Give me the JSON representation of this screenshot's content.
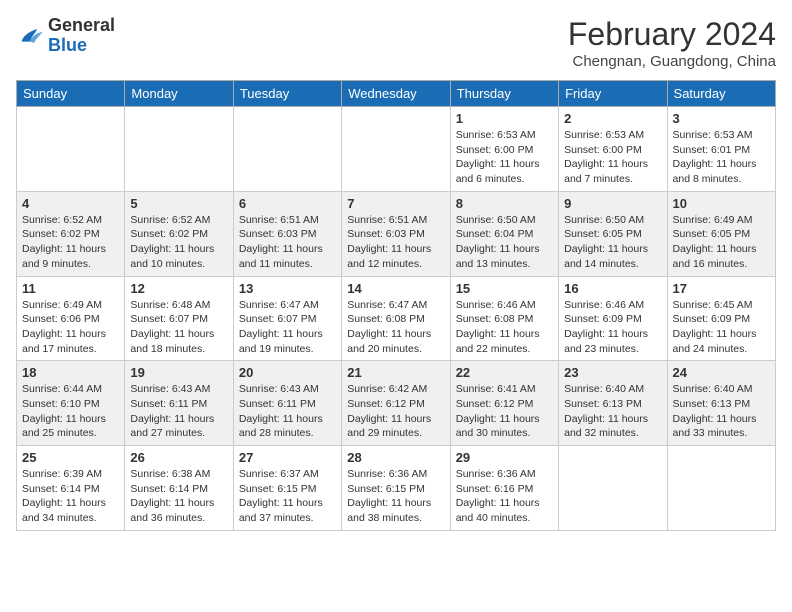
{
  "header": {
    "logo_general": "General",
    "logo_blue": "Blue",
    "month_title": "February 2024",
    "location": "Chengnan, Guangdong, China"
  },
  "weekdays": [
    "Sunday",
    "Monday",
    "Tuesday",
    "Wednesday",
    "Thursday",
    "Friday",
    "Saturday"
  ],
  "weeks": [
    [
      {
        "day": "",
        "info": ""
      },
      {
        "day": "",
        "info": ""
      },
      {
        "day": "",
        "info": ""
      },
      {
        "day": "",
        "info": ""
      },
      {
        "day": "1",
        "info": "Sunrise: 6:53 AM\nSunset: 6:00 PM\nDaylight: 11 hours and 6 minutes."
      },
      {
        "day": "2",
        "info": "Sunrise: 6:53 AM\nSunset: 6:00 PM\nDaylight: 11 hours and 7 minutes."
      },
      {
        "day": "3",
        "info": "Sunrise: 6:53 AM\nSunset: 6:01 PM\nDaylight: 11 hours and 8 minutes."
      }
    ],
    [
      {
        "day": "4",
        "info": "Sunrise: 6:52 AM\nSunset: 6:02 PM\nDaylight: 11 hours and 9 minutes."
      },
      {
        "day": "5",
        "info": "Sunrise: 6:52 AM\nSunset: 6:02 PM\nDaylight: 11 hours and 10 minutes."
      },
      {
        "day": "6",
        "info": "Sunrise: 6:51 AM\nSunset: 6:03 PM\nDaylight: 11 hours and 11 minutes."
      },
      {
        "day": "7",
        "info": "Sunrise: 6:51 AM\nSunset: 6:03 PM\nDaylight: 11 hours and 12 minutes."
      },
      {
        "day": "8",
        "info": "Sunrise: 6:50 AM\nSunset: 6:04 PM\nDaylight: 11 hours and 13 minutes."
      },
      {
        "day": "9",
        "info": "Sunrise: 6:50 AM\nSunset: 6:05 PM\nDaylight: 11 hours and 14 minutes."
      },
      {
        "day": "10",
        "info": "Sunrise: 6:49 AM\nSunset: 6:05 PM\nDaylight: 11 hours and 16 minutes."
      }
    ],
    [
      {
        "day": "11",
        "info": "Sunrise: 6:49 AM\nSunset: 6:06 PM\nDaylight: 11 hours and 17 minutes."
      },
      {
        "day": "12",
        "info": "Sunrise: 6:48 AM\nSunset: 6:07 PM\nDaylight: 11 hours and 18 minutes."
      },
      {
        "day": "13",
        "info": "Sunrise: 6:47 AM\nSunset: 6:07 PM\nDaylight: 11 hours and 19 minutes."
      },
      {
        "day": "14",
        "info": "Sunrise: 6:47 AM\nSunset: 6:08 PM\nDaylight: 11 hours and 20 minutes."
      },
      {
        "day": "15",
        "info": "Sunrise: 6:46 AM\nSunset: 6:08 PM\nDaylight: 11 hours and 22 minutes."
      },
      {
        "day": "16",
        "info": "Sunrise: 6:46 AM\nSunset: 6:09 PM\nDaylight: 11 hours and 23 minutes."
      },
      {
        "day": "17",
        "info": "Sunrise: 6:45 AM\nSunset: 6:09 PM\nDaylight: 11 hours and 24 minutes."
      }
    ],
    [
      {
        "day": "18",
        "info": "Sunrise: 6:44 AM\nSunset: 6:10 PM\nDaylight: 11 hours and 25 minutes."
      },
      {
        "day": "19",
        "info": "Sunrise: 6:43 AM\nSunset: 6:11 PM\nDaylight: 11 hours and 27 minutes."
      },
      {
        "day": "20",
        "info": "Sunrise: 6:43 AM\nSunset: 6:11 PM\nDaylight: 11 hours and 28 minutes."
      },
      {
        "day": "21",
        "info": "Sunrise: 6:42 AM\nSunset: 6:12 PM\nDaylight: 11 hours and 29 minutes."
      },
      {
        "day": "22",
        "info": "Sunrise: 6:41 AM\nSunset: 6:12 PM\nDaylight: 11 hours and 30 minutes."
      },
      {
        "day": "23",
        "info": "Sunrise: 6:40 AM\nSunset: 6:13 PM\nDaylight: 11 hours and 32 minutes."
      },
      {
        "day": "24",
        "info": "Sunrise: 6:40 AM\nSunset: 6:13 PM\nDaylight: 11 hours and 33 minutes."
      }
    ],
    [
      {
        "day": "25",
        "info": "Sunrise: 6:39 AM\nSunset: 6:14 PM\nDaylight: 11 hours and 34 minutes."
      },
      {
        "day": "26",
        "info": "Sunrise: 6:38 AM\nSunset: 6:14 PM\nDaylight: 11 hours and 36 minutes."
      },
      {
        "day": "27",
        "info": "Sunrise: 6:37 AM\nSunset: 6:15 PM\nDaylight: 11 hours and 37 minutes."
      },
      {
        "day": "28",
        "info": "Sunrise: 6:36 AM\nSunset: 6:15 PM\nDaylight: 11 hours and 38 minutes."
      },
      {
        "day": "29",
        "info": "Sunrise: 6:36 AM\nSunset: 6:16 PM\nDaylight: 11 hours and 40 minutes."
      },
      {
        "day": "",
        "info": ""
      },
      {
        "day": "",
        "info": ""
      }
    ]
  ]
}
